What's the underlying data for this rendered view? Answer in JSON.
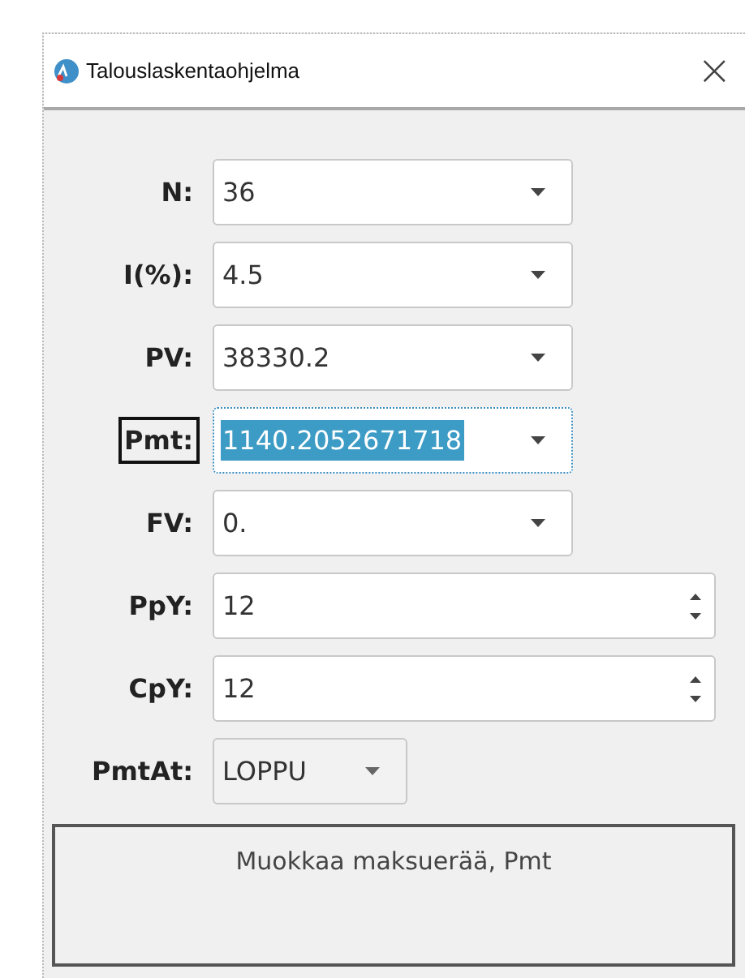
{
  "window": {
    "title": "Talouslaskentaohjelma",
    "close": "×"
  },
  "fields": [
    {
      "label": "N:",
      "kind": "combo",
      "value": "36",
      "focused": false
    },
    {
      "label": "I(%):",
      "kind": "combo",
      "value": "4.5",
      "focused": false
    },
    {
      "label": "PV:",
      "kind": "combo",
      "value": "38330.2",
      "focused": false
    },
    {
      "label": "Pmt:",
      "kind": "combo",
      "value": "1140.2052671718",
      "focused": true
    },
    {
      "label": "FV:",
      "kind": "combo",
      "value": "0.",
      "focused": false
    },
    {
      "label": "PpY:",
      "kind": "spin",
      "value": "12",
      "focused": false
    },
    {
      "label": "CpY:",
      "kind": "spin",
      "value": "12",
      "focused": false
    },
    {
      "label": "PmtAt:",
      "kind": "dropdown",
      "value": "LOPPU",
      "focused": false
    }
  ],
  "message": "Muokkaa maksuerää, Pmt"
}
